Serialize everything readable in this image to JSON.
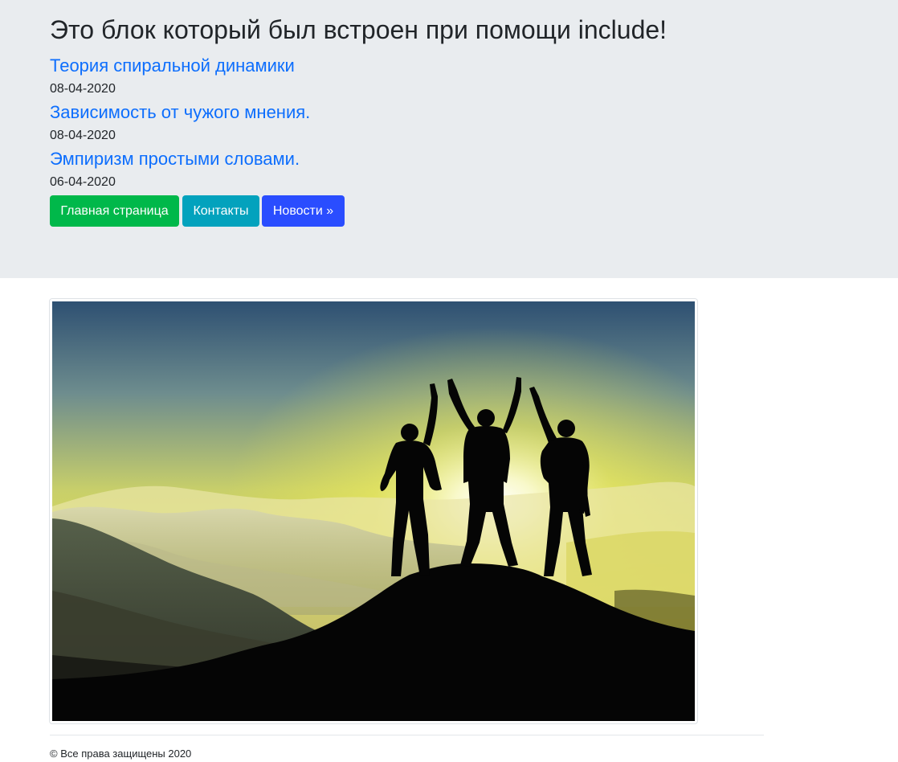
{
  "header": {
    "title": "Это блок который был встроен при помощи include!"
  },
  "articles": [
    {
      "title": "Теория спиральной динамики",
      "date": "08-04-2020"
    },
    {
      "title": "Зависимость от чужого мнения.",
      "date": "08-04-2020"
    },
    {
      "title": "Эмпиризм простыми словами.",
      "date": "06-04-2020"
    }
  ],
  "buttons": {
    "home": "Главная страница",
    "contacts": "Контакты",
    "news": "Новости »"
  },
  "colors": {
    "jumbotron_bg": "#e9ecef",
    "link": "#0d6efd",
    "home_button": "#00b84a",
    "contacts_button": "#03a2bd",
    "news_button": "#2a4dff"
  },
  "footer": {
    "copyright": "© Все права защищены 2020"
  }
}
